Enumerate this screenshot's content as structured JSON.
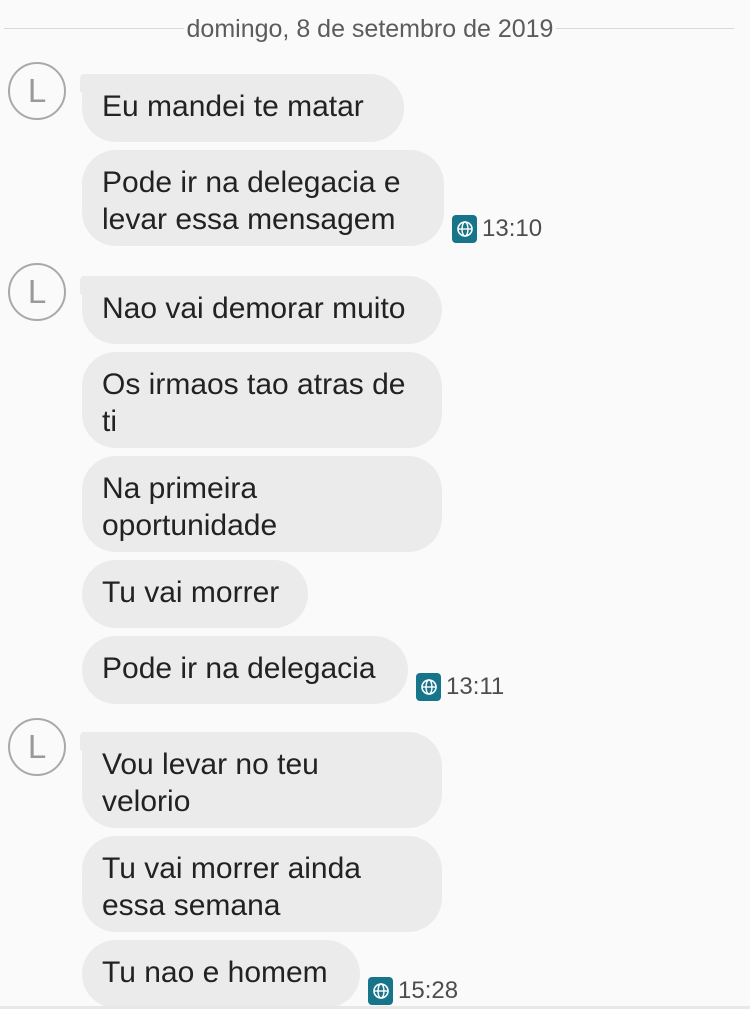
{
  "conversation": {
    "date": "domingo, 8 de setembro de 2019",
    "groups": [
      {
        "avatar": "L",
        "messages": [
          {
            "text": "Eu mandei te matar"
          },
          {
            "text": "Pode ir na delegacia e\nlevar essa mensagem"
          }
        ],
        "time": "13:10",
        "sim_icon": "globe-sim-icon"
      },
      {
        "avatar": "L",
        "messages": [
          {
            "text": "Nao vai demorar muito"
          },
          {
            "text": "Os irmaos tao atras de\nti"
          },
          {
            "text": "Na primeira\noportunidade"
          },
          {
            "text": "Tu vai morrer"
          },
          {
            "text": "Pode ir na delegacia"
          }
        ],
        "time": "13:11",
        "sim_icon": "globe-sim-icon"
      },
      {
        "avatar": "L",
        "messages": [
          {
            "text": "Vou levar no teu\nvelorio"
          },
          {
            "text": "Tu vai morrer ainda\nessa semana"
          },
          {
            "text": "Tu nao e homem"
          }
        ],
        "time": "15:28",
        "sim_icon": "globe-sim-icon"
      }
    ]
  },
  "colors": {
    "background": "#fafafa",
    "bubble": "#ebebeb",
    "sim_accent": "#17758a",
    "text": "#222222",
    "meta_text": "#4d4d4d"
  }
}
